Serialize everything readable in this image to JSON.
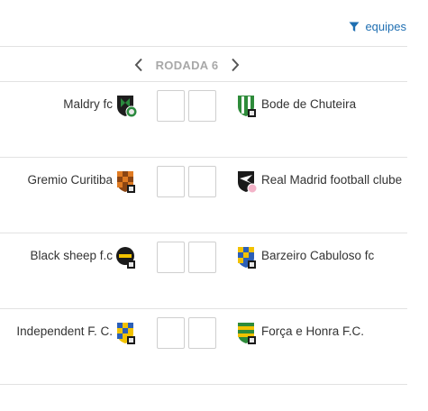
{
  "header": {
    "filter_label": "equipes"
  },
  "round": {
    "label": "RODADA 6"
  },
  "colors": {
    "link": "#1f6fb2",
    "round_label": "#a8a8a8",
    "divider": "#e2e2e2"
  },
  "matches": [
    {
      "home": {
        "name": "Maldry fc",
        "crest": "black-green-shield-crest"
      },
      "away": {
        "name": "Bode de Chuteira",
        "crest": "green-white-striped-crest"
      },
      "home_score": "",
      "away_score": ""
    },
    {
      "home": {
        "name": "Gremio Curitiba",
        "crest": "brown-orange-checkered-crest"
      },
      "away": {
        "name": "Real Madrid football clube",
        "crest": "black-white-crest"
      },
      "home_score": "",
      "away_score": ""
    },
    {
      "home": {
        "name": "Black sheep f.c",
        "crest": "black-yellow-circle-crest"
      },
      "away": {
        "name": "Barzeiro Cabuloso fc",
        "crest": "blue-yellow-checkered-crest"
      },
      "home_score": "",
      "away_score": ""
    },
    {
      "home": {
        "name": "Independent F. C.",
        "crest": "blue-yellow-checkered-crest"
      },
      "away": {
        "name": "Força e Honra F.C.",
        "crest": "green-yellow-striped-crest"
      },
      "home_score": "",
      "away_score": ""
    }
  ]
}
